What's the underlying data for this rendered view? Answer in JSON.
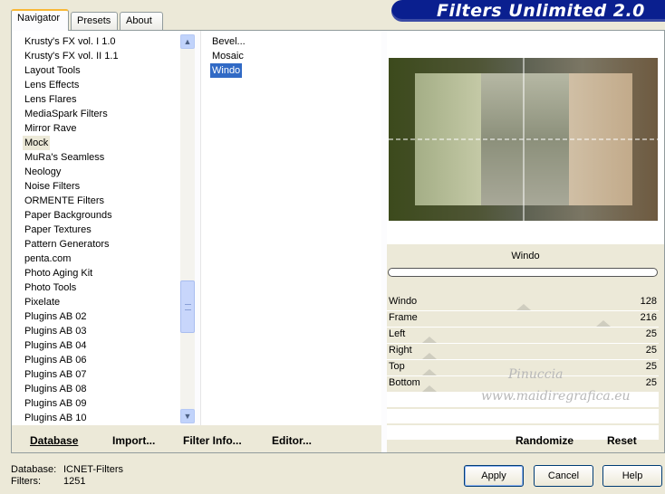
{
  "tabs": [
    "Navigator",
    "Presets",
    "About"
  ],
  "title": "Filters Unlimited 2.0",
  "categories": [
    "Krusty's FX vol. I 1.0",
    "Krusty's FX vol. II 1.1",
    "Layout Tools",
    "Lens Effects",
    "Lens Flares",
    "MediaSpark Filters",
    "Mirror Rave",
    "Mock",
    "MuRa's Seamless",
    "Neology",
    "Noise Filters",
    "ORMENTE Filters",
    "Paper Backgrounds",
    "Paper Textures",
    "Pattern Generators",
    "penta.com",
    "Photo Aging Kit",
    "Photo Tools",
    "Pixelate",
    "Plugins AB 02",
    "Plugins AB 03",
    "Plugins AB 04",
    "Plugins AB 06",
    "Plugins AB 07",
    "Plugins AB 08",
    "Plugins AB 09",
    "Plugins AB 10"
  ],
  "selected_category": "Mock",
  "filters": [
    "Bevel...",
    "Mosaic",
    "Windo"
  ],
  "selected_filter": "Windo",
  "preview": {
    "filter_name": "Windo"
  },
  "params": [
    {
      "label": "Windo",
      "value": "128",
      "level": 128
    },
    {
      "label": "Frame",
      "value": "216",
      "level": 216
    },
    {
      "label": "Left",
      "value": "25",
      "level": 25
    },
    {
      "label": "Right",
      "value": "25",
      "level": 25
    },
    {
      "label": "Top",
      "value": "25",
      "level": 25
    },
    {
      "label": "Bottom",
      "value": "25",
      "level": 25
    }
  ],
  "buttons_bottom": {
    "database": "Database",
    "import": "Import...",
    "filter_info": "Filter Info...",
    "editor": "Editor...",
    "randomize": "Randomize",
    "reset": "Reset"
  },
  "status": {
    "database_label": "Database:",
    "database_value": "ICNET-Filters",
    "filters_label": "Filters:",
    "filters_value": "1251"
  },
  "dialog_buttons": {
    "apply": "Apply",
    "cancel": "Cancel",
    "help": "Help"
  },
  "watermark": [
    "Pinuccia",
    "www.maidiregrafica.eu"
  ],
  "colors": {
    "banner": "#0a1f8f",
    "selection": "#316ac5",
    "tab_highlight": "#f9b836"
  }
}
